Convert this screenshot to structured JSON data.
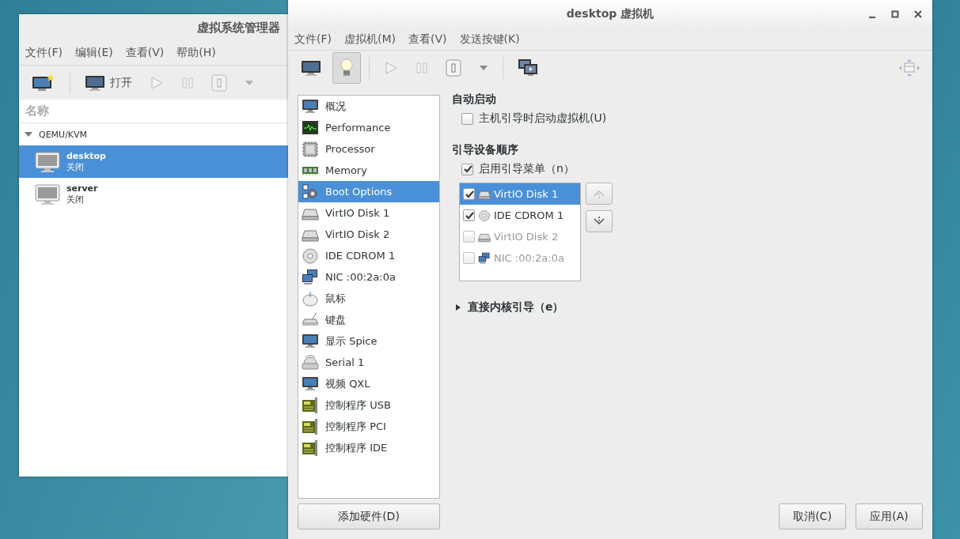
{
  "manager": {
    "title": "虚拟系统管理器",
    "menu": [
      "文件(F)",
      "编辑(E)",
      "查看(V)",
      "帮助(H)"
    ],
    "toolbar": [
      {
        "kind": "new",
        "disabled": false
      },
      {
        "kind": "separator"
      },
      {
        "kind": "open",
        "label": "打开",
        "disabled": false
      },
      {
        "kind": "run",
        "disabled": true
      },
      {
        "kind": "pause",
        "disabled": true
      },
      {
        "kind": "shutdown",
        "disabled": true
      },
      {
        "kind": "dropdown",
        "disabled": true
      }
    ],
    "column": "名称",
    "connection": {
      "name": "QEMU/KVM",
      "expanded": true
    },
    "vms": [
      {
        "name": "desktop",
        "status": "关闭",
        "selected": true
      },
      {
        "name": "server",
        "status": "关闭",
        "selected": false
      }
    ]
  },
  "vm_window": {
    "title": "desktop 虚拟机",
    "menu": [
      "文件(F)",
      "虚拟机(M)",
      "查看(V)",
      "发送按键(K)"
    ],
    "toolbar": [
      {
        "kind": "console",
        "selected": false,
        "disabled": false
      },
      {
        "kind": "details",
        "selected": true,
        "disabled": false
      },
      {
        "kind": "separator"
      },
      {
        "kind": "run",
        "selected": false,
        "disabled": true
      },
      {
        "kind": "pause",
        "selected": false,
        "disabled": true
      },
      {
        "kind": "shutdown",
        "selected": false,
        "disabled": false
      },
      {
        "kind": "dropdown",
        "selected": false,
        "disabled": false
      },
      {
        "kind": "separator"
      },
      {
        "kind": "snapshots",
        "selected": false,
        "disabled": false
      }
    ],
    "hardware": [
      {
        "label": "概况",
        "kind": "monitor",
        "selected": false
      },
      {
        "label": "Performance",
        "kind": "performance",
        "selected": false
      },
      {
        "label": "Processor",
        "kind": "cpu",
        "selected": false
      },
      {
        "label": "Memory",
        "kind": "memory",
        "selected": false
      },
      {
        "label": "Boot Options",
        "kind": "boot",
        "selected": true
      },
      {
        "label": "VirtIO Disk 1",
        "kind": "disk",
        "selected": false
      },
      {
        "label": "VirtIO Disk 2",
        "kind": "disk",
        "selected": false
      },
      {
        "label": "IDE CDROM 1",
        "kind": "cdrom",
        "selected": false
      },
      {
        "label": "NIC :00:2a:0a",
        "kind": "nic",
        "selected": false
      },
      {
        "label": "鼠标",
        "kind": "mouse",
        "selected": false
      },
      {
        "label": "键盘",
        "kind": "keyboard",
        "selected": false
      },
      {
        "label": "显示 Spice",
        "kind": "display",
        "selected": false
      },
      {
        "label": "Serial 1",
        "kind": "serial",
        "selected": false
      },
      {
        "label": "视频 QXL",
        "kind": "display",
        "selected": false
      },
      {
        "label": "控制程序 USB",
        "kind": "controller",
        "selected": false
      },
      {
        "label": "控制程序 PCI",
        "kind": "controller",
        "selected": false
      },
      {
        "label": "控制程序 IDE",
        "kind": "controller",
        "selected": false
      }
    ],
    "add_hardware": "添加硬件(D)",
    "autostart": {
      "heading": "自动启动",
      "checkbox": {
        "label": "主机引导时启动虚拟机(U)",
        "checked": false
      }
    },
    "boot_order": {
      "heading": "引导设备顺序",
      "boot_menu": {
        "label": "启用引导菜单（n）",
        "checked": true
      },
      "devices": [
        {
          "label": "VirtIO Disk 1",
          "kind": "disk",
          "checked": true,
          "selected": true
        },
        {
          "label": "IDE CDROM 1",
          "kind": "cdrom",
          "checked": true,
          "selected": false
        },
        {
          "label": "VirtIO Disk 2",
          "kind": "disk",
          "checked": false,
          "selected": false
        },
        {
          "label": "NIC :00:2a:0a",
          "kind": "nic",
          "checked": false,
          "selected": false
        }
      ],
      "move_up": {
        "disabled": true
      },
      "move_down": {
        "disabled": false
      }
    },
    "direct_kernel_boot": {
      "label": "直接内核引导（e）",
      "expanded": false
    },
    "buttons": [
      "取消(C)",
      "应用(A)"
    ]
  }
}
